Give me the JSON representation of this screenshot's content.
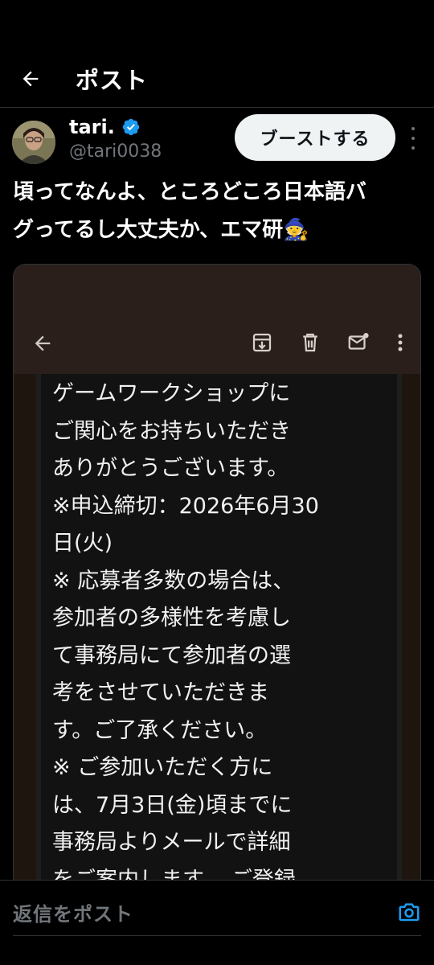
{
  "header": {
    "title": "ポスト"
  },
  "author": {
    "name": "tari.",
    "handle": "@tari0038"
  },
  "actions": {
    "boost_label": "ブーストする"
  },
  "tweet": {
    "text": "頃ってなんよ、ところどころ日本語バ\nグってるし大丈夫か、エマ研🧙"
  },
  "media": {
    "mail_text": "ゲームワークショップに\nご関心をお持ちいただき\nありがとうございます。\n※申込締切：2026年6月30\n日(火)\n※ 応募者多数の場合は、\n参加者の多様性を考慮し\nて事務局にて参加者の選\n考をさせていただきま\nす。ご了承ください。\n※ ご参加いただく方に\nは、7月3日(金)頃までに\n事務局よりメールで詳細\nをご案内します。 ご登録"
  },
  "reply": {
    "placeholder": "返信をポスト"
  },
  "colors": {
    "accent": "#1d9bf0",
    "background": "#000000",
    "muted": "#71767b"
  },
  "icons": [
    "back-arrow-icon",
    "verified-badge-icon",
    "more-icon",
    "archive-icon",
    "trash-icon",
    "mail-unread-icon",
    "camera-icon"
  ]
}
